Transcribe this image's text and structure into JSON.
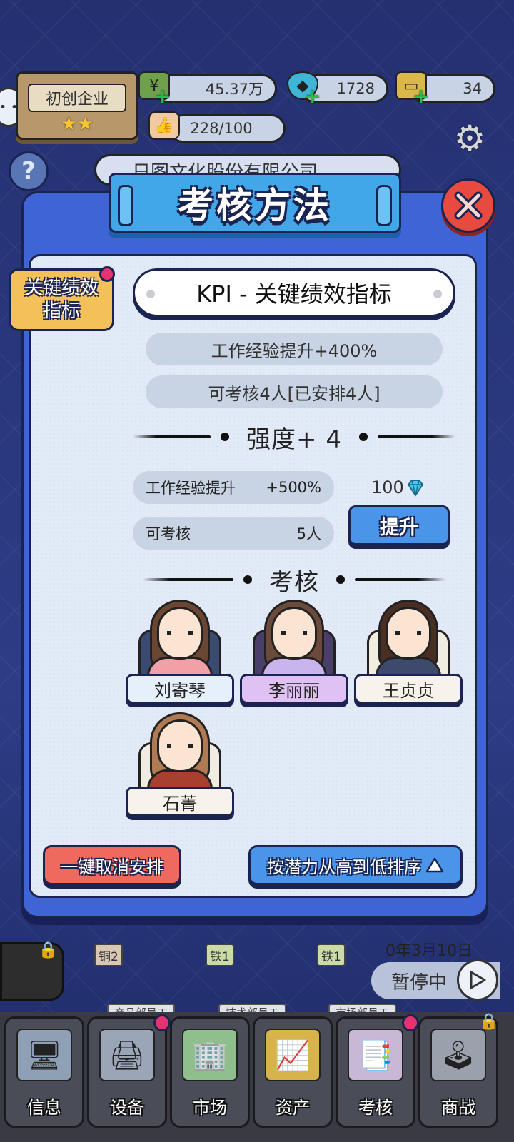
{
  "hud": {
    "company_rank": "初创企业",
    "stars": "★★",
    "money": "45.37万",
    "diamonds": "1728",
    "tickets": "34",
    "likes": "228/100",
    "company_name": "日图文化股份有限公司"
  },
  "modal": {
    "title": "考核方法",
    "method_tag_line1": "关键绩效",
    "method_tag_line2": "指标",
    "method_name": "KPI - 关键绩效指标",
    "effect": "工作经验提升+400%",
    "capacity": "可考核4人[已安排4人]",
    "strength_heading": "强度+ 4",
    "next_effect_label": "工作经验提升",
    "next_effect_value": "+500%",
    "next_capacity_label": "可考核",
    "next_capacity_value": "5人",
    "upgrade_cost": "100",
    "upgrade_label": "提升",
    "review_heading": "考核",
    "employees": [
      {
        "name": "刘寄琴",
        "plate_color": "#e6f0fb",
        "chair_color": "#3a4a70",
        "hair_color": "#6b4632",
        "shirt_color": "#f2a0a8"
      },
      {
        "name": "李丽丽",
        "plate_color": "#dfc2f3",
        "chair_color": "#4a3f6a",
        "hair_color": "#6b4a3c",
        "shirt_color": "#c9b4ee"
      },
      {
        "name": "王贞贞",
        "plate_color": "#f8f3ea",
        "chair_color": "#f1ece2",
        "hair_color": "#4a2e22",
        "shirt_color": "#3d4a6e"
      },
      {
        "name": "石菁",
        "plate_color": "#f8f3ea",
        "chair_color": "#f1ece2",
        "hair_color": "#b07a52",
        "shirt_color": "#a8402f"
      }
    ],
    "cancel_label": "一键取消安排",
    "sort_label": "按潜力从高到低排序"
  },
  "game": {
    "date": "0年3月10日",
    "pause_label": "暂停中",
    "rank_tags": [
      "铜2",
      "铁1",
      "铁1"
    ],
    "desk_labels": [
      "产品部员工",
      "技术部员工",
      "市场部员工"
    ]
  },
  "tabs": [
    {
      "label": "信息",
      "icon": "monitor-icon"
    },
    {
      "label": "设备",
      "icon": "printer-icon"
    },
    {
      "label": "市场",
      "icon": "building-icon"
    },
    {
      "label": "资产",
      "icon": "chart-icon"
    },
    {
      "label": "考核",
      "icon": "documents-icon"
    },
    {
      "label": "商战",
      "icon": "joystick-icon"
    }
  ],
  "colors": {
    "modal_blue": "#3e64d6",
    "panel": "#e1eaf6",
    "title_blue": "#41a7e9",
    "close_red": "#e94a3f",
    "badge_pink": "#e6336f",
    "button_blue": "#4a95ea",
    "button_red": "#ef6a5e",
    "tag_gold": "#f3c05a"
  }
}
